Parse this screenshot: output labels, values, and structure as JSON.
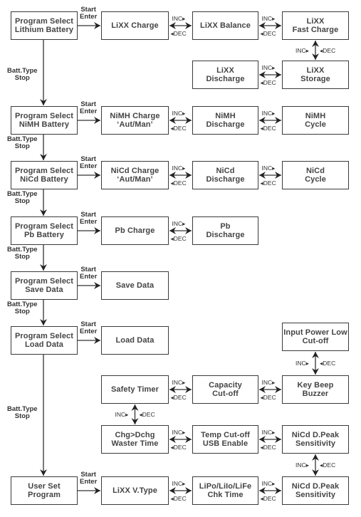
{
  "diagram": {
    "type": "menu-flowchart",
    "labels": {
      "start_enter": [
        "Start",
        "Enter"
      ],
      "batt_type_stop": [
        "Batt.Type",
        "Stop"
      ],
      "inc": "INC▸",
      "dec": "◂DEC",
      "inc_v": "INC▸",
      "dec_v": "◂DEC"
    },
    "program_select": [
      {
        "id": "lithium",
        "lines": [
          "Program Select",
          "Lithium Battery"
        ]
      },
      {
        "id": "nimh",
        "lines": [
          "Program Select",
          "NiMH Battery"
        ]
      },
      {
        "id": "nicd",
        "lines": [
          "Program Select",
          "NiCd Battery"
        ]
      },
      {
        "id": "pb",
        "lines": [
          "Program Select",
          "Pb Battery"
        ]
      },
      {
        "id": "save",
        "lines": [
          "Program Select",
          "Save Data"
        ]
      },
      {
        "id": "load",
        "lines": [
          "Program Select",
          "Load Data"
        ]
      },
      {
        "id": "user",
        "lines": [
          "User Set",
          "Program"
        ]
      }
    ],
    "nodes": {
      "lixx_charge": [
        "LiXX Charge"
      ],
      "lixx_balance": [
        "LiXX Balance"
      ],
      "lixx_fast_charge": [
        "LiXX",
        "Fast Charge"
      ],
      "lixx_discharge": [
        "LiXX",
        "Discharge"
      ],
      "lixx_storage": [
        "LiXX",
        "Storage"
      ],
      "nimh_charge": [
        "NiMH Charge",
        "‘Aut/Man’"
      ],
      "nimh_discharge": [
        "NiMH",
        "Discharge"
      ],
      "nimh_cycle": [
        "NiMH",
        "Cycle"
      ],
      "nicd_charge": [
        "NiCd Charge",
        "‘Aut/Man’"
      ],
      "nicd_discharge": [
        "NiCd",
        "Discharge"
      ],
      "nicd_cycle": [
        "NiCd",
        "Cycle"
      ],
      "pb_charge": [
        "Pb Charge"
      ],
      "pb_discharge": [
        "Pb",
        "Discharge"
      ],
      "save_data": [
        "Save Data"
      ],
      "load_data": [
        "Load Data"
      ],
      "input_power_low": [
        "Input Power Low",
        "Cut-off"
      ],
      "safety_timer": [
        "Safety Timer"
      ],
      "capacity_cutoff": [
        "Capacity",
        "Cut-off"
      ],
      "key_beep": [
        "Key Beep",
        "Buzzer"
      ],
      "chg_dchg_waste": [
        "Chg>Dchg",
        "Waster Time"
      ],
      "temp_cutoff": [
        "Temp Cut-off",
        "USB Enable"
      ],
      "nicd_dpeak_1": [
        "NiCd D.Peak",
        "Sensitivity"
      ],
      "lixx_vtype": [
        "LiXX V.Type"
      ],
      "lipo_chk_time": [
        "LiPo/LiIo/LiFe",
        "Chk Time"
      ],
      "nicd_dpeak_2": [
        "NiCd D.Peak",
        "Sensitivity"
      ]
    }
  }
}
